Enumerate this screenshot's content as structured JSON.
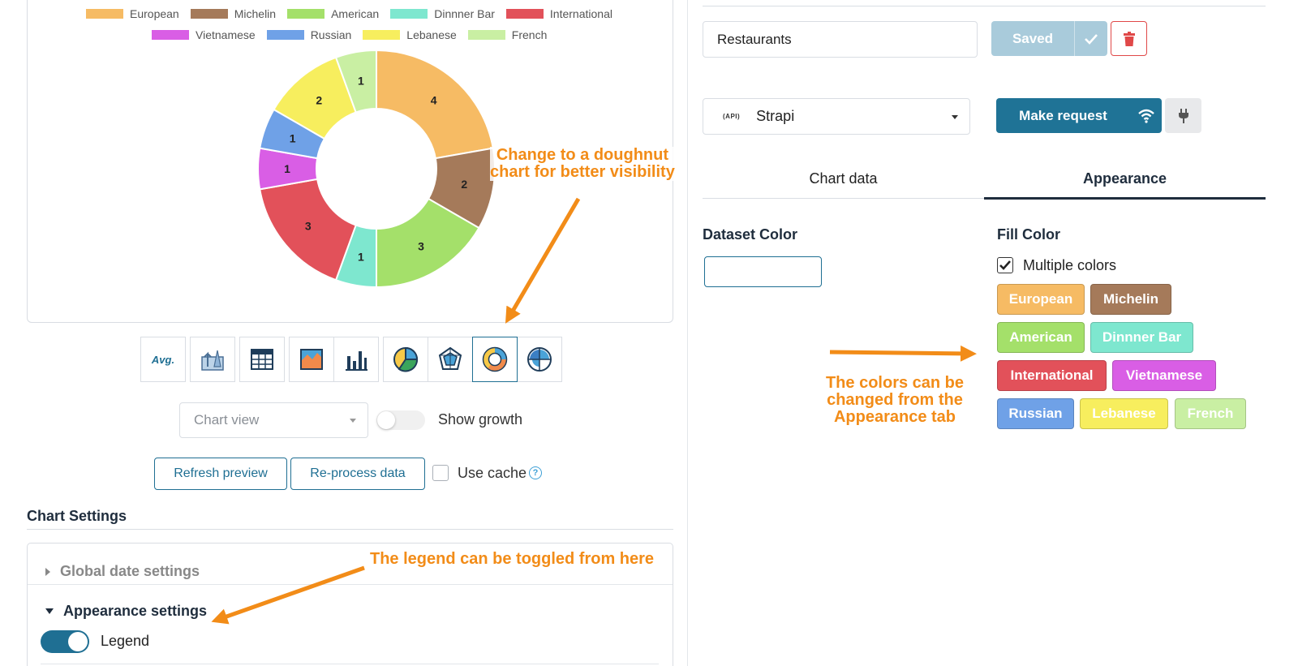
{
  "chart_data": {
    "type": "pie",
    "variant": "doughnut",
    "categories": [
      "European",
      "Michelin",
      "American",
      "Dinnner Bar",
      "International",
      "Vietnamese",
      "Russian",
      "Lebanese",
      "French"
    ],
    "values": [
      4,
      2,
      3,
      1,
      3,
      1,
      1,
      2,
      1
    ],
    "colors": [
      "#f6bb64",
      "#a57a5a",
      "#a4e06a",
      "#7ee7cf",
      "#e2515a",
      "#d95ee5",
      "#6fa1e7",
      "#f7ee5e",
      "#c9efa3"
    ],
    "legend_placement": "top",
    "title": ""
  },
  "toolbar": {
    "icons": [
      "avg-icon",
      "growth-chart-icon",
      "table-icon",
      "area-chart-icon",
      "bar-chart-icon",
      "pie-chart-icon",
      "radar-chart-icon",
      "doughnut-chart-icon",
      "polar-chart-icon"
    ],
    "avg_label": "Avg.",
    "active": "doughnut-chart-icon"
  },
  "controls": {
    "chart_view_placeholder": "Chart view",
    "show_growth_label": "Show growth",
    "refresh_label": "Refresh preview",
    "reprocess_label": "Re-process data",
    "use_cache_label": "Use cache",
    "help_glyph": "?"
  },
  "settings": {
    "title": "Chart Settings",
    "global_date_label": "Global date settings",
    "appearance_label": "Appearance settings",
    "legend_label": "Legend",
    "legend_enabled": true
  },
  "header": {
    "chart_name": "Restaurants",
    "saved_label": "Saved"
  },
  "request": {
    "api_badge": "(API)",
    "source": "Strapi",
    "make_request_label": "Make request"
  },
  "tabs": {
    "chart_data": "Chart data",
    "appearance": "Appearance",
    "active": "appearance"
  },
  "appearance": {
    "dataset_color_label": "Dataset Color",
    "fill_color_label": "Fill Color",
    "multiple_colors_label": "Multiple colors",
    "multiple_colors_checked": true,
    "fill_colors": [
      {
        "label": "European",
        "color": "#f6bb64"
      },
      {
        "label": "Michelin",
        "color": "#a57a5a"
      },
      {
        "label": "American",
        "color": "#a4e06a"
      },
      {
        "label": "Dinnner Bar",
        "color": "#7ee7cf"
      },
      {
        "label": "International",
        "color": "#e2515a"
      },
      {
        "label": "Vietnamese",
        "color": "#d95ee5"
      },
      {
        "label": "Russian",
        "color": "#6fa1e7"
      },
      {
        "label": "Lebanese",
        "color": "#f7ee5e"
      },
      {
        "label": "French",
        "color": "#c9efa3"
      }
    ]
  },
  "annotations": {
    "doughnut_note": [
      "Change to a doughnut",
      "chart for better visibility"
    ],
    "colors_note": [
      "The colors can be",
      "changed from the",
      "Appearance tab"
    ],
    "legend_note": "The legend can be toggled from here",
    "accent_color": "#f28c18"
  }
}
